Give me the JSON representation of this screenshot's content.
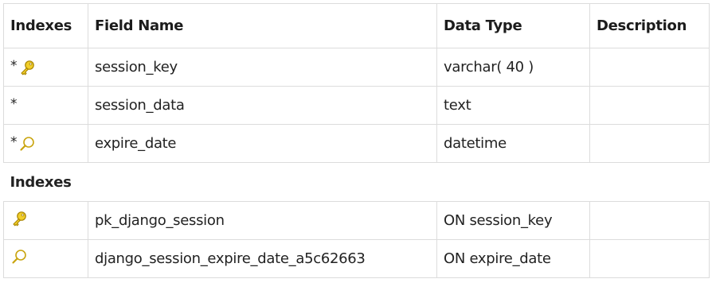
{
  "table": {
    "headers": {
      "indexes": "Indexes",
      "field_name": "Field Name",
      "data_type": "Data Type",
      "description": "Description"
    },
    "fields": [
      {
        "marker": "*",
        "icon": "key-icon",
        "name": "session_key",
        "type": "varchar( 40 )",
        "description": ""
      },
      {
        "marker": "*",
        "icon": "",
        "name": "session_data",
        "type": "text",
        "description": ""
      },
      {
        "marker": "*",
        "icon": "magnifier-icon",
        "name": "expire_date",
        "type": "datetime",
        "description": ""
      }
    ],
    "indexes_section_title": "Indexes",
    "indexes": [
      {
        "icon": "key-icon",
        "name": "pk_django_session",
        "definition": "ON session_key",
        "description": ""
      },
      {
        "icon": "magnifier-icon",
        "name": "django_session_expire_date_a5c62663",
        "definition": "ON expire_date",
        "description": ""
      }
    ]
  },
  "colors": {
    "border": "#dcdcdc",
    "key_icon": "#e8c21c",
    "magnifier_icon": "#c9a40e"
  }
}
